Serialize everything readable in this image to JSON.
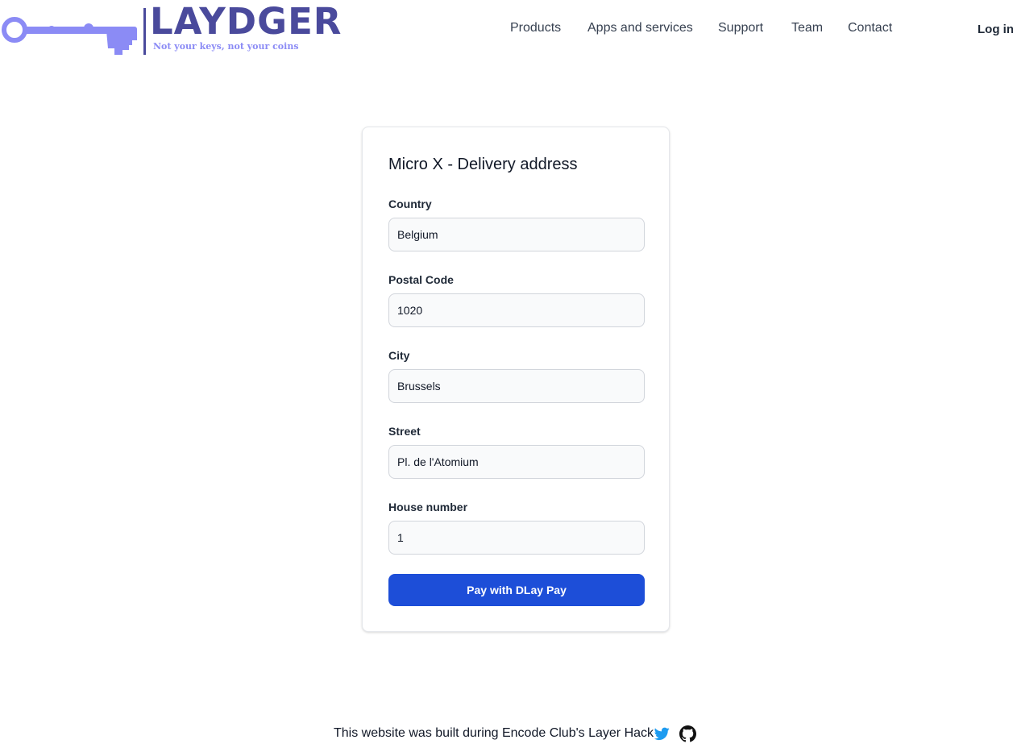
{
  "header": {
    "logo": {
      "wordmark": "LAYDGER",
      "tagline": "Not your keys, not your coins",
      "icon": "key-icon"
    },
    "nav": [
      {
        "label": "Products"
      },
      {
        "label": "Apps and services"
      },
      {
        "label": "Support"
      },
      {
        "label": "Team"
      },
      {
        "label": "Contact"
      }
    ],
    "login_label": "Log in"
  },
  "form": {
    "title": "Micro X - Delivery address",
    "fields": [
      {
        "label": "Country",
        "value": "Belgium"
      },
      {
        "label": "Postal Code",
        "value": "1020"
      },
      {
        "label": "City",
        "value": "Brussels"
      },
      {
        "label": "Street",
        "value": "Pl. de l'Atomium"
      },
      {
        "label": "House number",
        "value": "1"
      }
    ],
    "submit_label": "Pay with DLay Pay"
  },
  "footer": {
    "text": "This website was built during Encode Club's Layer Hack",
    "icons": [
      "twitter-icon",
      "github-icon"
    ]
  },
  "colors": {
    "brand": "#4a4a9c",
    "brand_light": "#8b8bf5",
    "button": "#1d4ed8",
    "twitter": "#1d9bf0"
  }
}
